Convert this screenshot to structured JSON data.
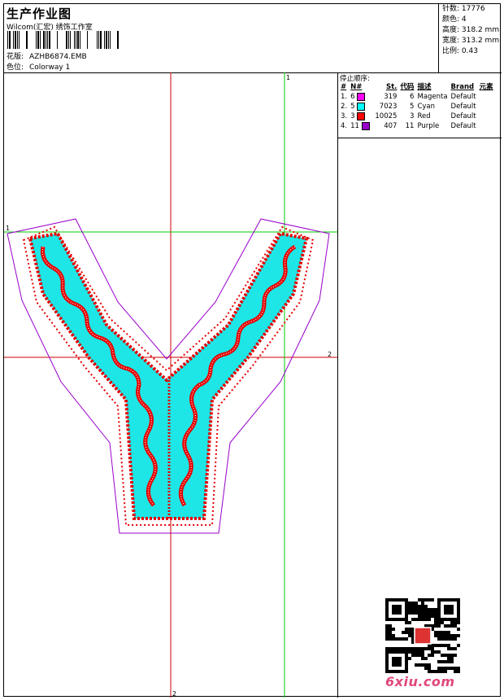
{
  "header": {
    "title": "生产作业图",
    "software": "Wilcom(汇宏) 绣饰工作室",
    "design_label": "花版:",
    "design_value": "AZHB6874.EMB",
    "colorway_label": "色位:",
    "colorway_value": "Colorway 1"
  },
  "stats": [
    {
      "label": "针数:",
      "value": "17776"
    },
    {
      "label": "颜色:",
      "value": "4"
    },
    {
      "label": "高度:",
      "value": "318.2 mm"
    },
    {
      "label": "宽度:",
      "value": "313.2 mm"
    },
    {
      "label": "比例:",
      "value": "0.43"
    }
  ],
  "sequence": {
    "title": "停止顺序:",
    "columns": [
      "#",
      "N#",
      "St.",
      "代码",
      "描述",
      "Brand",
      "元素"
    ],
    "rows": [
      {
        "idx": "1.",
        "n": "6",
        "color": "#ff00ff",
        "st": "319",
        "code": "6",
        "desc": "Magenta",
        "brand": "Default"
      },
      {
        "idx": "2.",
        "n": "5",
        "color": "#00ffff",
        "st": "7023",
        "code": "5",
        "desc": "Cyan",
        "brand": "Default"
      },
      {
        "idx": "3.",
        "n": "3",
        "color": "#ff0000",
        "st": "10025",
        "code": "3",
        "desc": "Red",
        "brand": "Default"
      },
      {
        "idx": "4.",
        "n": "11",
        "color": "#9900cc",
        "st": "407",
        "code": "11",
        "desc": "Purple",
        "brand": "Default"
      }
    ]
  },
  "guides": {
    "h1": "1",
    "h2": "2",
    "v1": "1",
    "v2": "2"
  },
  "colors": {
    "red": "#e60000",
    "cyan": "#1ee6e6",
    "purple": "#9900cc",
    "guide_red": "#cc0000",
    "guide_green": "#00cc00"
  },
  "watermark": "6xiu.com"
}
